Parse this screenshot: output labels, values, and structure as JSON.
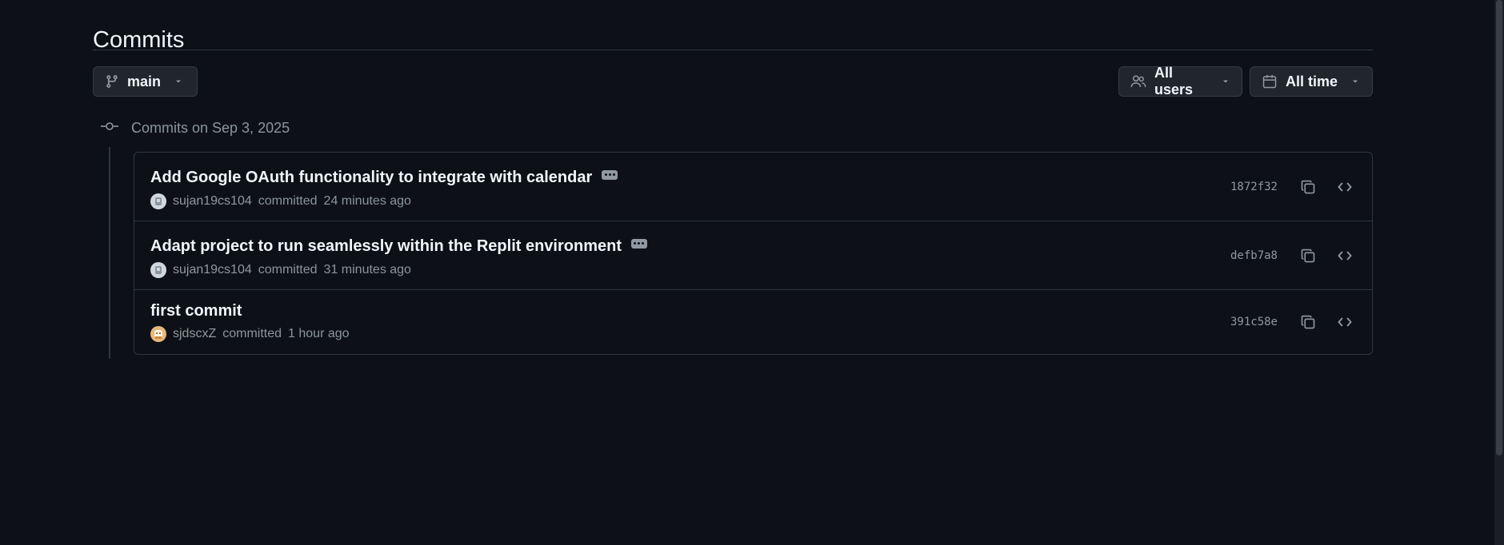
{
  "page": {
    "title": "Commits"
  },
  "filters": {
    "branch": "main",
    "users": "All users",
    "time": "All time"
  },
  "day_group": {
    "label": "Commits on Sep 3, 2025"
  },
  "commits": [
    {
      "message": "Add Google OAuth functionality to integrate with calendar",
      "author": "sujan19cs104",
      "action": "committed",
      "time": "24 minutes ago",
      "sha": "1872f32",
      "has_ellipsis": true
    },
    {
      "message": "Adapt project to run seamlessly within the Replit environment",
      "author": "sujan19cs104",
      "action": "committed",
      "time": "31 minutes ago",
      "sha": "defb7a8",
      "has_ellipsis": true
    },
    {
      "message": "first commit",
      "author": "sjdscxZ",
      "action": "committed",
      "time": "1 hour ago",
      "sha": "391c58e",
      "has_ellipsis": false
    }
  ],
  "colors": {
    "background": "#0d1117",
    "border": "#30363d",
    "text_primary": "#f0f6fc",
    "text_muted": "#8b949e"
  },
  "icons": {
    "branch": "git-branch-icon",
    "users": "people-icon",
    "time": "calendar-icon",
    "commit_node": "git-commit-icon",
    "copy": "copy-icon",
    "browse": "code-icon"
  }
}
